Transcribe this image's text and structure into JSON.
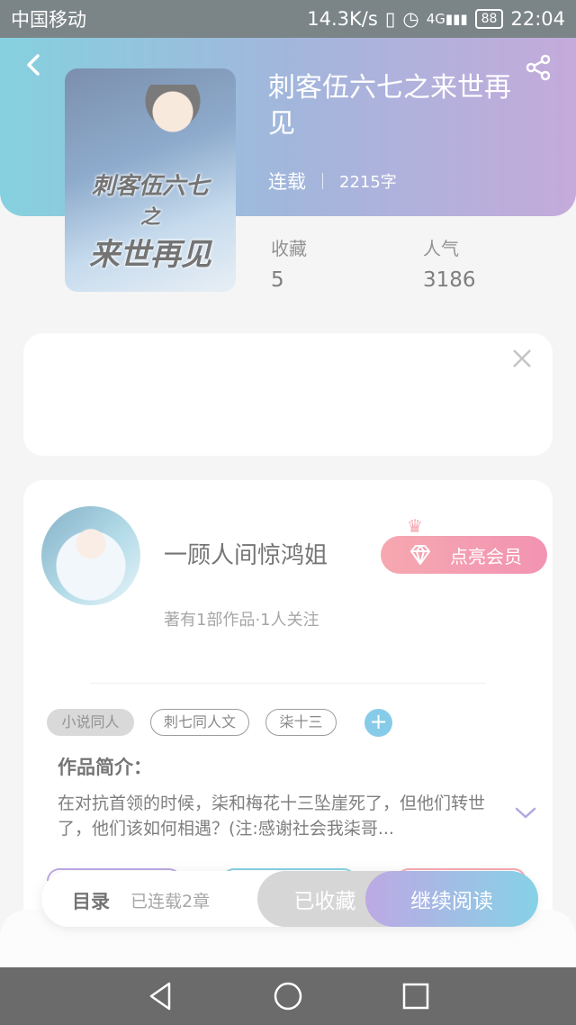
{
  "status_bar": {
    "carrier": "中国移动",
    "speed": "14.3K/s",
    "battery": "88",
    "time": "22:04"
  },
  "book": {
    "title": "刺客伍六七之来世再见",
    "status": "连载",
    "word_count": "2215字",
    "cover_text": [
      "刺客伍六七",
      "之",
      "来世再见"
    ],
    "stats": [
      {
        "label": "收藏",
        "value": "5"
      },
      {
        "label": "人气",
        "value": "3186"
      }
    ]
  },
  "author": {
    "name": "一顾人间惊鸿姐",
    "vip_button": "点亮会员",
    "summary": "著有1部作品·1人关注"
  },
  "tags": [
    "小说同人",
    "刺七同人文",
    "柒十三"
  ],
  "intro": {
    "title": "作品简介：",
    "text": "在对抗首领的时候，柒和梅花十三坠崖死了，但他们转世了，他们该如何相遇？(注:感谢社会我柒哥..."
  },
  "bottom_bar": {
    "toc_label": "目录",
    "toc_sub": "已连载2章",
    "collected": "已收藏",
    "continue": "继续阅读"
  },
  "icons": {
    "back": "back-icon",
    "share": "share-icon",
    "close": "close-icon",
    "diamond": "diamond-icon",
    "crown": "crown-icon",
    "add": "add-tag-icon",
    "expand": "chevron-down-icon"
  },
  "colors": {
    "header_gradient_start": "#2eb0c8",
    "header_gradient_end": "#9a6ec2",
    "vip_pink": "#f06a78",
    "read_gradient_start": "#8d6bd1",
    "read_gradient_end": "#2fb1d4"
  }
}
